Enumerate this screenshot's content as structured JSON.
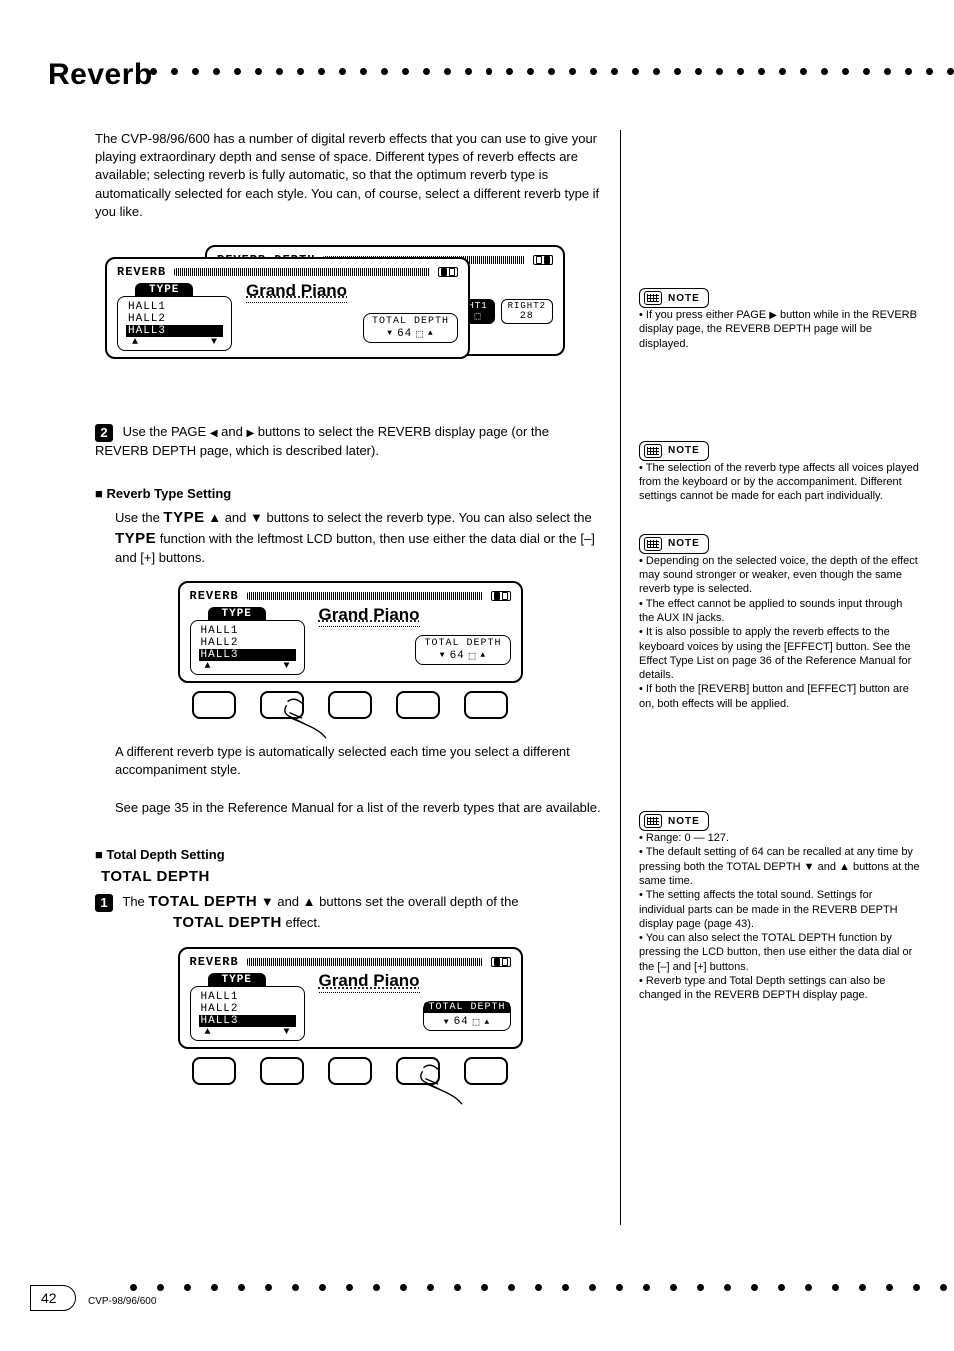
{
  "heading": "Reverb",
  "intro": {
    "line1": "The CVP-98/96/600 has a number of digital reverb effects that you can use to",
    "line2": "give your playing extraordinary depth and sense of space. Different types of",
    "line3": "reverb effects are available; selecting reverb is fully automatic, so that the",
    "line4": "optimum reverb type is automatically selected for each style. You can, of",
    "line5": "course, select a different reverb type if you like."
  },
  "lcd1": {
    "title_back": "REVERB DEPTH",
    "title_front": "REVERB",
    "voice": "Grand Piano",
    "type_label": "TYPE",
    "types": [
      "HALL1",
      "HALL2",
      "HALL3"
    ],
    "total_depth_label": "TOTAL DEPTH",
    "total_depth_value": "64",
    "right_tab1": "HT1",
    "right_tab2": "RIGHT2",
    "right_tab2_val": "28"
  },
  "step2": {
    "num": "2",
    "text_a": "Use the PAGE ",
    "text_b": " and ",
    "text_c": " buttons to select the REVERB display page (or the REVERB DEPTH page, which is described later)."
  },
  "type_section": {
    "title": "Reverb Type Setting",
    "line1_a": "Use the ",
    "line1_b": "TYPE",
    "line1_c": " ▲ and ▼ buttons to select the reverb type. You can also select the",
    "line2_a": "TYPE",
    "line2_b": " function with the leftmost LCD button, then use either the data dial or the [–] and [+] buttons."
  },
  "lcd2": {
    "title": "REVERB",
    "voice": "Grand Piano",
    "type_label": "TYPE",
    "types": [
      "HALL1",
      "HALL2",
      "HALL3"
    ],
    "total_depth_label": "TOTAL DEPTH",
    "total_depth_value": "64"
  },
  "after_text1": "A different reverb type is automatically selected each time you select a different accompaniment style.",
  "after_text2": "See page 35 in the Reference Manual for a list of the reverb types that are available.",
  "total_depth": {
    "heading": "Total Depth Setting",
    "sub": "TOTAL DEPTH",
    "step_num": "1",
    "step_a": "The ",
    "step_b": "TOTAL DEPTH",
    "step_c": " ▼ and ▲ buttons set the overall depth of the",
    "line2_a": "TOTAL DEPTH",
    "line2_b": " effect."
  },
  "lcd3": {
    "title": "REVERB",
    "voice": "Grand Piano",
    "type_label": "TYPE",
    "types": [
      "HALL1",
      "HALL2",
      "HALL3"
    ],
    "total_depth_label": "TOTAL DEPTH",
    "total_depth_value": "64"
  },
  "notes": {
    "n1": {
      "a": "If you press either PAGE ",
      "b": " button while in the REVERB display page, the REVERB DEPTH page will be displayed."
    },
    "n2": "The selection of the reverb type affects all voices played from the keyboard or by the accompaniment. Different settings cannot be made for each part individually.",
    "n3": {
      "a": "Depending on the selected voice, the depth of the effect may sound stronger or weaker, even though the same reverb type is selected.",
      "b": "The effect cannot be applied to sounds input through the AUX IN jacks.",
      "c": "It is also possible to apply the reverb effects to the keyboard voices by using the [EFFECT] button. See the Effect Type List on page 36 of the Reference Manual for details.",
      "d": "If both the [REVERB] button and [EFFECT] button are on, both effects will be applied."
    },
    "n4": {
      "a": "Range: 0 — 127.",
      "b": "The default setting of 64 can be recalled at any time by pressing both the TOTAL DEPTH ▼ and ▲ buttons at the same time.",
      "c": "The setting affects the total sound. Settings for individual parts can be made in the REVERB DEPTH display page (page 43).",
      "d": "You can also select the TOTAL DEPTH function by pressing the LCD button, then use either the data dial or the [–] and [+] buttons.",
      "e": "Reverb type and Total Depth settings can also be changed in the REVERB DEPTH display page."
    }
  },
  "footer": {
    "page": "42",
    "ref": "CVP-98/96/600"
  }
}
